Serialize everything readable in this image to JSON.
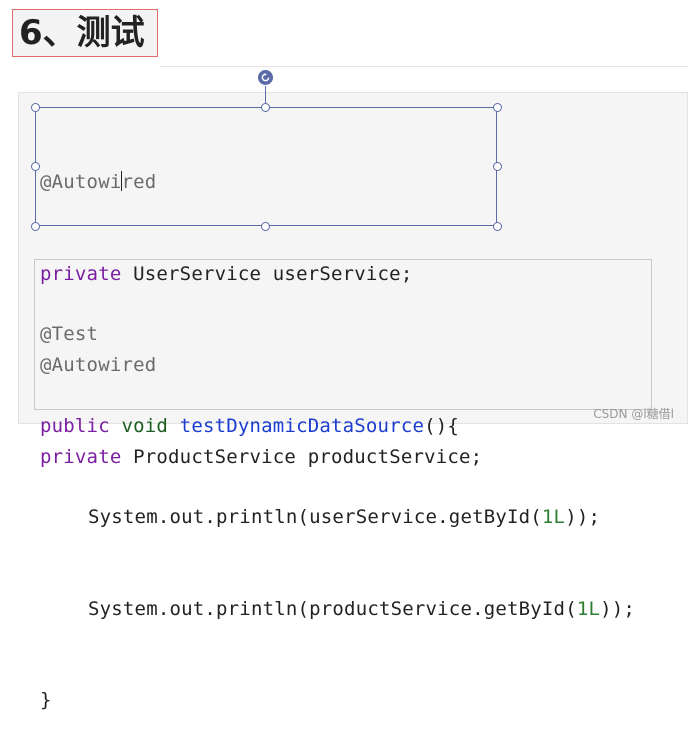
{
  "heading": {
    "title": "6、测试"
  },
  "code_block_1": {
    "lines": [
      {
        "annotation": "@Autowi",
        "annotation_rest": "red"
      },
      {
        "keyword": "private",
        "type": "UserService",
        "name": "userService;"
      },
      {
        "annotation": "@Autowired"
      },
      {
        "keyword": "private",
        "type": "ProductService",
        "name": "productService;"
      }
    ]
  },
  "code_block_2": {
    "annotation": "@Test",
    "signature": {
      "modifier": "public",
      "return_type": "void",
      "method": "testDynamicDataSource",
      "params": "(){"
    },
    "statements": [
      {
        "prefix": "System.out.println(userService.getById(",
        "literal": "1L",
        "suffix": "));"
      },
      {
        "prefix": "System.out.println(productService.getById(",
        "literal": "1L",
        "suffix": "));"
      }
    ],
    "closing": "}"
  },
  "icons": {
    "rotate_handle": "rotate-icon"
  },
  "colors": {
    "selection": "#5a6ba8",
    "keyword": "#7b1fa2",
    "type_keyword": "#1b5e20",
    "method": "#1a3ccf",
    "number": "#2e7d32",
    "annotation": "#6b6b6b"
  },
  "watermark": "CSDN @l糖借l"
}
